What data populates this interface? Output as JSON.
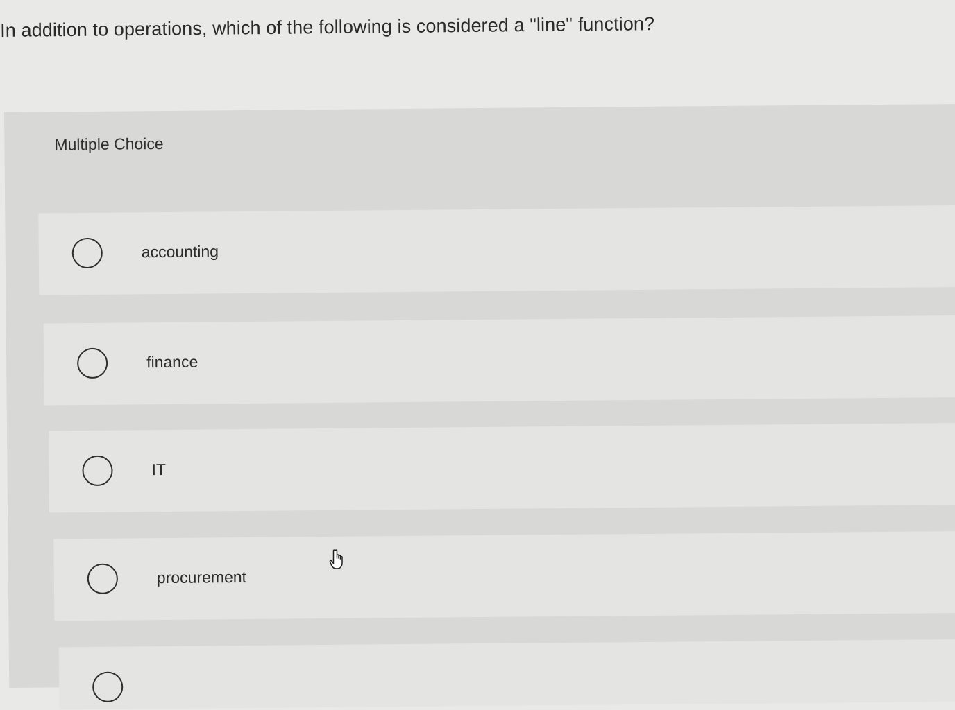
{
  "question": {
    "text": "In addition to operations, which of the following is considered a \"line\" function?"
  },
  "choices": {
    "header": "Multiple Choice",
    "options": [
      {
        "label": "accounting"
      },
      {
        "label": "finance"
      },
      {
        "label": "IT"
      },
      {
        "label": "procurement"
      },
      {
        "label": ""
      }
    ]
  },
  "cursor": {
    "icon": "hand-pointer-icon"
  }
}
